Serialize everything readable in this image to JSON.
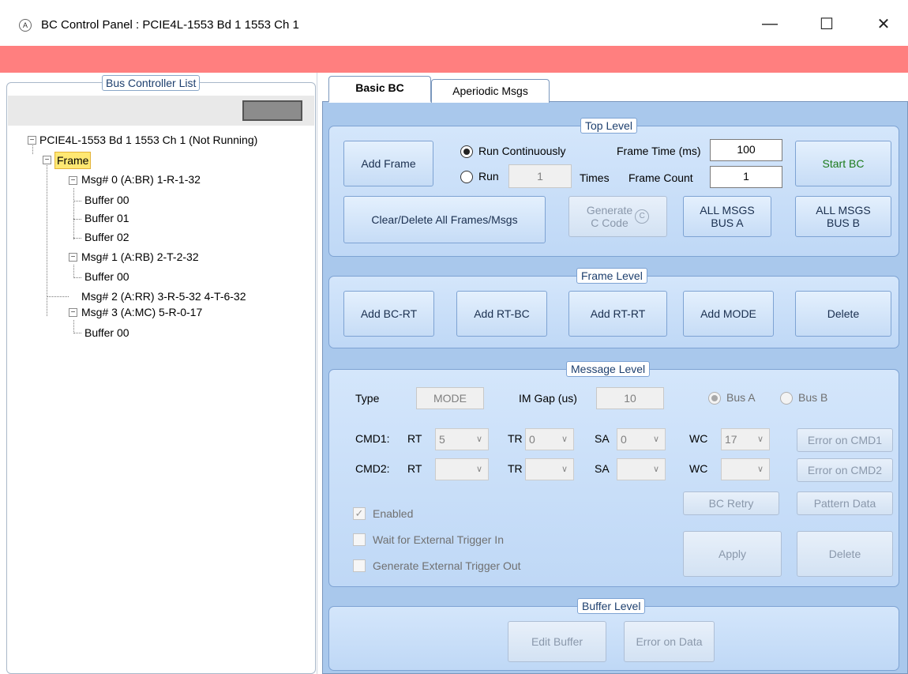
{
  "window": {
    "title": "BC Control Panel : PCIE4L-1553 Bd 1 1553 Ch 1",
    "app_icon_text": "A",
    "minimize_glyph": "—",
    "maximize_glyph": "☐",
    "close_glyph": "✕",
    "alert_color": "#ff7f7f"
  },
  "left": {
    "legend": "Bus Controller List",
    "tree": {
      "root": "PCIE4L-1553 Bd 1 1553 Ch 1 (Not Running)",
      "frame": "Frame",
      "msg0": "Msg# 0 (A:BR) 1-R-1-32",
      "msg0_buf0": "Buffer 00",
      "msg0_buf1": "Buffer 01",
      "msg0_buf2": "Buffer 02",
      "msg1": "Msg# 1 (A:RB) 2-T-2-32",
      "msg1_buf0": "Buffer 00",
      "msg2": "Msg# 2 (A:RR) 3-R-5-32 4-T-6-32",
      "msg3": "Msg# 3 (A:MC) 5-R-0-17",
      "msg3_buf0": "Buffer 00",
      "expanded_glyph": "−"
    }
  },
  "tabs": [
    {
      "label": "Basic BC",
      "active": true
    },
    {
      "label": "Aperiodic Msgs",
      "active": false
    }
  ],
  "top_level": {
    "legend": "Top Level",
    "add_frame": "Add Frame",
    "run_continuously": "Run Continuously",
    "run": "Run",
    "run_times_value": "1",
    "times": "Times",
    "frame_time_label": "Frame Time (ms)",
    "frame_time_value": "100",
    "frame_count_label": "Frame Count",
    "frame_count_value": "1",
    "start_bc": "Start BC",
    "clear_delete": "Clear/Delete All Frames/Msgs",
    "generate_line1": "Generate",
    "generate_line2": "C Code",
    "c_icon_text": "C",
    "all_msgs_a_line1": "ALL MSGS",
    "all_msgs_a_line2": "BUS A",
    "all_msgs_b_line1": "ALL MSGS",
    "all_msgs_b_line2": "BUS B"
  },
  "frame_level": {
    "legend": "Frame Level",
    "add_bc_rt": "Add BC-RT",
    "add_rt_bc": "Add RT-BC",
    "add_rt_rt": "Add RT-RT",
    "add_mode": "Add MODE",
    "delete": "Delete"
  },
  "message_level": {
    "legend": "Message Level",
    "type_label": "Type",
    "type_value": "MODE",
    "im_gap_label": "IM Gap (us)",
    "im_gap_value": "10",
    "bus_a": "Bus A",
    "bus_b": "Bus B",
    "cmd1_label": "CMD1:",
    "cmd2_label": "CMD2:",
    "rt_label": "RT",
    "tr_label": "TR",
    "sa_label": "SA",
    "wc_label": "WC",
    "cmd1_rt": "5",
    "cmd1_tr": "0",
    "cmd1_sa": "0",
    "cmd1_wc": "17",
    "cmd2_rt": "",
    "cmd2_tr": "",
    "cmd2_sa": "",
    "cmd2_wc": "",
    "dropdown_glyph": "∨",
    "error_cmd1": "Error on CMD1",
    "error_cmd2": "Error on CMD2",
    "bc_retry": "BC Retry",
    "pattern_data": "Pattern Data",
    "enabled": "Enabled",
    "check_glyph": "✓",
    "wait_trigger": "Wait for External Trigger In",
    "gen_trigger": "Generate External Trigger Out",
    "apply": "Apply",
    "delete": "Delete"
  },
  "buffer_level": {
    "legend": "Buffer Level",
    "edit_buffer": "Edit Buffer",
    "error_on_data": "Error on Data"
  }
}
